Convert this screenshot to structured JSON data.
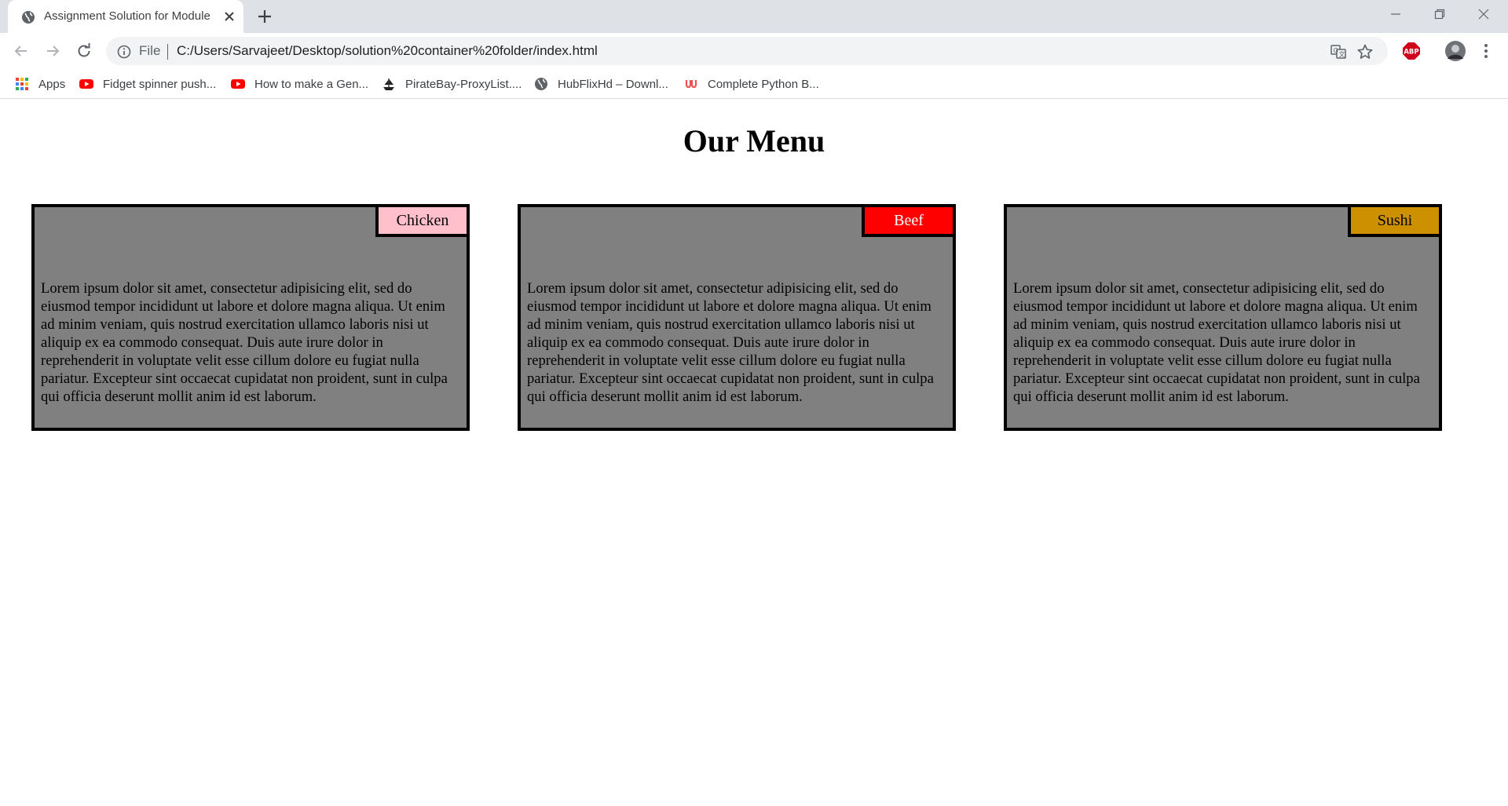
{
  "browser": {
    "tab_title": "Assignment Solution for Module",
    "omnibox": {
      "scheme_label": "File",
      "url": "C:/Users/Sarvajeet/Desktop/solution%20container%20folder/index.html"
    },
    "bookmarks": [
      {
        "label": "Apps",
        "icon": "apps-grid-icon"
      },
      {
        "label": "Fidget spinner push...",
        "icon": "youtube-icon"
      },
      {
        "label": "How to make a Gen...",
        "icon": "youtube-icon"
      },
      {
        "label": "PirateBay-ProxyList....",
        "icon": "pirate-ship-icon"
      },
      {
        "label": "HubFlixHd – Downl...",
        "icon": "globe-icon"
      },
      {
        "label": "Complete Python B...",
        "icon": "udemy-icon"
      }
    ],
    "extensions": {
      "adblock_badge": "ABP"
    }
  },
  "page": {
    "title": "Our Menu",
    "cards": [
      {
        "label": "Chicken",
        "label_bg": "#ffc0cb",
        "label_color": "#000000",
        "text": "Lorem ipsum dolor sit amet, consectetur adipisicing elit, sed do eiusmod tempor incididunt ut labore et dolore magna aliqua. Ut enim ad minim veniam, quis nostrud exercitation ullamco laboris nisi ut aliquip ex ea commodo consequat. Duis aute irure dolor in reprehenderit in voluptate velit esse cillum dolore eu fugiat nulla pariatur. Excepteur sint occaecat cupidatat non proident, sunt in culpa qui officia deserunt mollit anim id est laborum."
      },
      {
        "label": "Beef",
        "label_bg": "#ff0000",
        "label_color": "#ffffff",
        "text": "Lorem ipsum dolor sit amet, consectetur adipisicing elit, sed do eiusmod tempor incididunt ut labore et dolore magna aliqua. Ut enim ad minim veniam, quis nostrud exercitation ullamco laboris nisi ut aliquip ex ea commodo consequat. Duis aute irure dolor in reprehenderit in voluptate velit esse cillum dolore eu fugiat nulla pariatur. Excepteur sint occaecat cupidatat non proident, sunt in culpa qui officia deserunt mollit anim id est laborum."
      },
      {
        "label": "Sushi",
        "label_bg": "#cc9000",
        "label_color": "#000000",
        "text": "Lorem ipsum dolor sit amet, consectetur adipisicing elit, sed do eiusmod tempor incididunt ut labore et dolore magna aliqua. Ut enim ad minim veniam, quis nostrud exercitation ullamco laboris nisi ut aliquip ex ea commodo consequat. Duis aute irure dolor in reprehenderit in voluptate velit esse cillum dolore eu fugiat nulla pariatur. Excepteur sint occaecat cupidatat non proident, sunt in culpa qui officia deserunt mollit anim id est laborum."
      }
    ],
    "card_bg": "#808080"
  }
}
